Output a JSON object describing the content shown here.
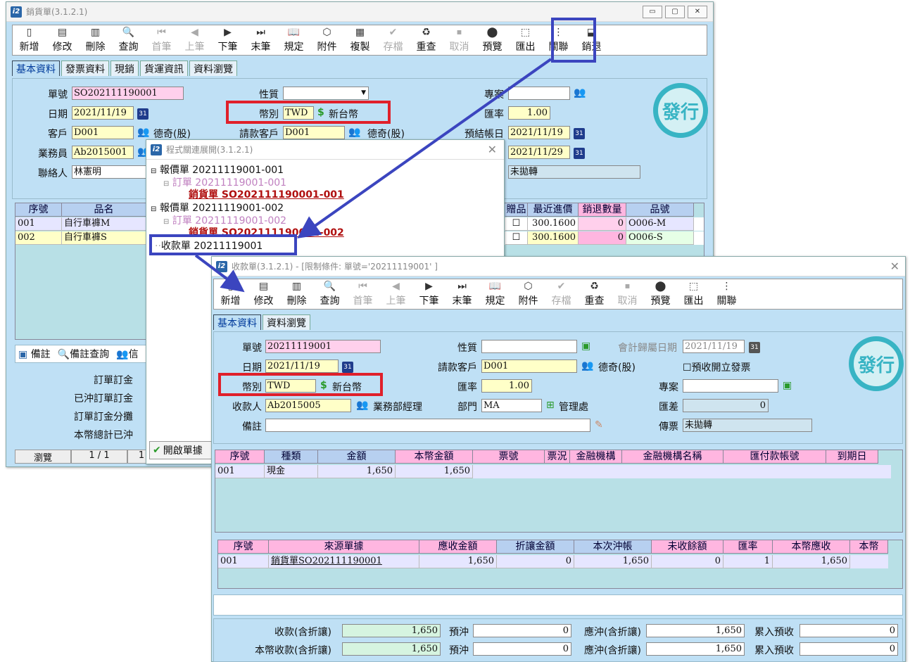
{
  "sales": {
    "title": "銷貨單(3.1.2.1)",
    "wbtns": [
      "▭",
      "▢",
      "✕"
    ],
    "toolbar": [
      {
        "l": "新增",
        "i": "▯",
        "d": false
      },
      {
        "l": "修改",
        "i": "▤",
        "d": false
      },
      {
        "l": "刪除",
        "i": "▥",
        "d": false
      },
      {
        "l": "查詢",
        "i": "🔍",
        "d": false
      },
      {
        "l": "首筆",
        "i": "⏮",
        "d": true
      },
      {
        "l": "上筆",
        "i": "◀",
        "d": true
      },
      {
        "l": "下筆",
        "i": "▶",
        "d": false
      },
      {
        "l": "末筆",
        "i": "⏭",
        "d": false
      },
      {
        "l": "規定",
        "i": "📖",
        "d": false
      },
      {
        "l": "附件",
        "i": "⬡",
        "d": false
      },
      {
        "l": "複製",
        "i": "▦",
        "d": false
      },
      {
        "l": "存檔",
        "i": "✔",
        "d": true
      },
      {
        "l": "重查",
        "i": "♻",
        "d": false
      },
      {
        "l": "取消",
        "i": "⏹",
        "d": true
      },
      {
        "l": "預覽",
        "i": "⬤",
        "d": false
      },
      {
        "l": "匯出",
        "i": "⬚",
        "d": false
      },
      {
        "l": "關聯",
        "i": "⋮",
        "d": false
      },
      {
        "l": "銷退",
        "i": "⬓",
        "d": false
      }
    ],
    "tabs": [
      "基本資料",
      "發票資料",
      "現銷",
      "貨運資訊",
      "資料瀏覽"
    ],
    "labels": {
      "no": "單號",
      "date": "日期",
      "cust": "客戶",
      "sales": "業務員",
      "contact": "聯絡人",
      "nature": "性質",
      "currency": "幣別",
      "billcust": "請款客戶",
      "project": "專案",
      "rate": "匯率",
      "settle": "預結帳日"
    },
    "no": "SO202111190001",
    "date": "2021/11/19",
    "cust": "D001",
    "cust_name": "德奇(股)",
    "salesman": "Ab2015001",
    "contact": "林憲明",
    "currency": "TWD",
    "currency_name": "新台幣",
    "billcust": "D001",
    "billcust_name": "德奇(股)",
    "rate": "1.00",
    "settle": "2021/11/19",
    "date2": "2021/11/29",
    "status": "未拋轉",
    "seal": "發行",
    "grid_head": [
      "序號",
      "品名",
      "贈品",
      "最近進價",
      "銷退數量",
      "品號"
    ],
    "rows": [
      {
        "seq": "001",
        "name": "自行車褲M",
        "price": "300.1600",
        "ret": "0",
        "code": "O006-M"
      },
      {
        "seq": "002",
        "name": "自行車褲S",
        "price": "300.1600",
        "ret": "0",
        "code": "O006-S"
      }
    ],
    "bottom_tabs": [
      "備註",
      "備註查詢",
      "信"
    ],
    "bottom_labels": [
      "訂單訂金",
      "已沖訂單訂金",
      "訂單訂金分攤",
      "本幣總計已沖"
    ],
    "status_bar": [
      "瀏覽",
      "1 / 1",
      "1"
    ]
  },
  "relation": {
    "title": "程式關連展開(3.1.2.1)",
    "tree": [
      "報價單 20211119001-001",
      "訂單 20211119001-001",
      "銷貨單 SO202111190001-001",
      "報價單 20211119001-002",
      "訂單 20211119001-002",
      "銷貨單 SO202111190001-002",
      "收款單 20211119001"
    ],
    "open_button": "開啟單據"
  },
  "receipt": {
    "title": "收款單(3.1.2.1) - [限制條件: 單號='20211119001' ]",
    "toolbar": [
      {
        "l": "新增",
        "i": "▯",
        "d": false
      },
      {
        "l": "修改",
        "i": "▤",
        "d": false
      },
      {
        "l": "刪除",
        "i": "▥",
        "d": false
      },
      {
        "l": "查詢",
        "i": "🔍",
        "d": false
      },
      {
        "l": "首筆",
        "i": "⏮",
        "d": true
      },
      {
        "l": "上筆",
        "i": "◀",
        "d": true
      },
      {
        "l": "下筆",
        "i": "▶",
        "d": false
      },
      {
        "l": "末筆",
        "i": "⏭",
        "d": false
      },
      {
        "l": "規定",
        "i": "📖",
        "d": false
      },
      {
        "l": "附件",
        "i": "⬡",
        "d": false
      },
      {
        "l": "存檔",
        "i": "✔",
        "d": true
      },
      {
        "l": "重查",
        "i": "♻",
        "d": false
      },
      {
        "l": "取消",
        "i": "⏹",
        "d": true
      },
      {
        "l": "預覽",
        "i": "⬤",
        "d": false
      },
      {
        "l": "匯出",
        "i": "⬚",
        "d": false
      },
      {
        "l": "關聯",
        "i": "⋮",
        "d": false
      }
    ],
    "tabs": [
      "基本資料",
      "資料瀏覽"
    ],
    "labels": {
      "no": "單號",
      "date": "日期",
      "currency": "幣別",
      "payee": "收款人",
      "note": "備註",
      "nature": "性質",
      "billcust": "請款客戶",
      "rate": "匯率",
      "dept": "部門",
      "acct_date": "會計歸屬日期",
      "advance": "預收開立發票",
      "project": "專案",
      "diff": "匯差",
      "voucher": "傳票"
    },
    "no": "20211119001",
    "date": "2021/11/19",
    "currency": "TWD",
    "currency_name": "新台幣",
    "payee": "Ab2015005",
    "payee_name": "業務部經理",
    "billcust": "D001",
    "billcust_name": "德奇(股)",
    "rate": "1.00",
    "dept": "MA",
    "dept_name": "管理處",
    "acct_date": "2021/11/19",
    "diff": "0",
    "voucher": "未拋轉",
    "seal": "發行",
    "grid1_head": [
      "序號",
      "種類",
      "金額",
      "本幣金額",
      "票號",
      "票況",
      "金融機構",
      "金融機構名稱",
      "匯付款帳號",
      "到期日"
    ],
    "grid1_rows": [
      {
        "seq": "001",
        "type": "現金",
        "amt": "1,650",
        "base": "1,650"
      }
    ],
    "grid2_head": [
      "序號",
      "來源單據",
      "應收金額",
      "折讓金額",
      "本次沖帳",
      "未收餘額",
      "匯率",
      "本幣應收",
      "本幣"
    ],
    "grid2_rows": [
      {
        "seq": "001",
        "src": "銷貨單SO202111190001",
        "recv": "1,650",
        "disc": "0",
        "cur": "1,650",
        "rem": "0",
        "rate": "1",
        "base": "1,650"
      }
    ],
    "totals": {
      "l1": "收款(含折讓)",
      "v1": "1,650",
      "l2": "預沖",
      "v2": "0",
      "l3": "應沖(含折讓)",
      "v3": "1,650",
      "l4": "累入預收",
      "v4": "0",
      "l5": "本幣收款(含折讓)",
      "v5": "1,650",
      "l6": "預沖",
      "v6": "0",
      "l7": "應沖(含折讓)",
      "v7": "1,650",
      "l8": "累入預收",
      "v8": "0"
    }
  }
}
